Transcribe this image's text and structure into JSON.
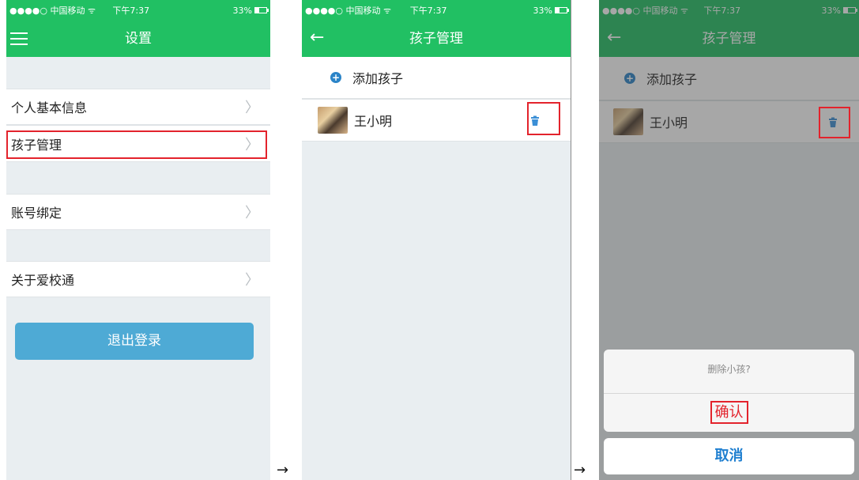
{
  "status": {
    "carrier": "●●●●○ 中国移动 ᯤ",
    "time": "下午7:37",
    "battery": "33%"
  },
  "screen1": {
    "title": "设置",
    "items": [
      "个人基本信息",
      "孩子管理",
      "账号绑定",
      "关于爱校通"
    ],
    "logout": "退出登录"
  },
  "screen2": {
    "title": "孩子管理",
    "add": "添加孩子",
    "child": "王小明"
  },
  "screen3": {
    "title": "孩子管理",
    "add": "添加孩子",
    "child": "王小明",
    "dialog_message": "删除小孩?",
    "confirm": "确认",
    "cancel": "取消"
  },
  "flow_arrow": "→",
  "colors": {
    "header": "#21c063",
    "highlight": "#e3232c",
    "logout": "#4eaad5",
    "cancel": "#1f7fd0"
  }
}
